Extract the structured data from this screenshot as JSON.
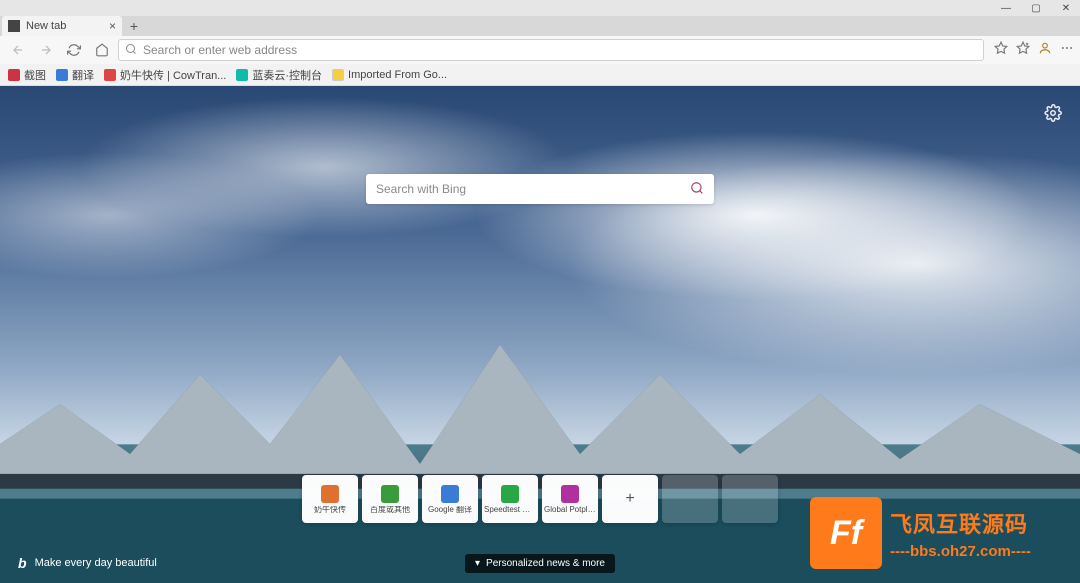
{
  "window": {
    "min": "—",
    "max": "▢",
    "close": "✕"
  },
  "tab": {
    "title": "New tab"
  },
  "nav": {
    "search_placeholder": "Search or enter web address"
  },
  "bookmarks": {
    "items": [
      {
        "label": "截图",
        "icon": "i-red"
      },
      {
        "label": "翻译",
        "icon": "i-blue"
      },
      {
        "label": "奶牛快传 | CowTran...",
        "icon": "i-red2"
      },
      {
        "label": "蓝奏云·控制台",
        "icon": "i-teal"
      },
      {
        "label": "Imported From Go...",
        "icon": "i-yel"
      }
    ]
  },
  "search": {
    "placeholder": "Search with Bing"
  },
  "tiles": [
    {
      "label": "奶牛快传",
      "icon_class": "g-orange"
    },
    {
      "label": "百度或其他",
      "icon_class": "g-green"
    },
    {
      "label": "Google 翻译",
      "icon_class": "g-blue"
    },
    {
      "label": "Speedtest 由...",
      "icon_class": "g-green2"
    },
    {
      "label": "Global Potplayer",
      "icon_class": "g-magenta"
    }
  ],
  "bing_credit": "Make every day beautiful",
  "news_pill": "Personalized news & more",
  "watermark": {
    "logo_letter": "Ff",
    "line1": "飞凤互联源码",
    "line2": "----bbs.oh27.com----"
  }
}
